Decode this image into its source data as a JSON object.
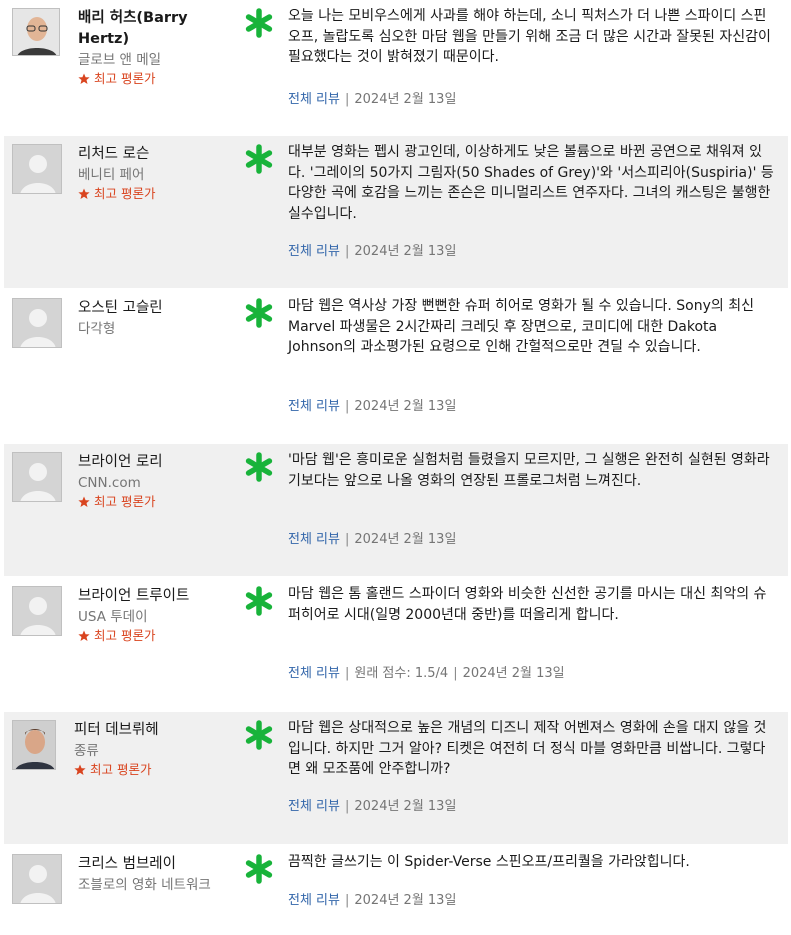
{
  "colors": {
    "accent_link": "#3366aa",
    "top_critic": "#d9441f",
    "fresh_icon": "#18b33a",
    "shaded_bg": "#f0f0f0"
  },
  "icons": {
    "fresh": "fresh-score-icon",
    "top_critic": "star-icon",
    "avatar_placeholder": "avatar-placeholder-icon"
  },
  "reviews": [
    {
      "critic": "배리 허츠(Barry Hertz)",
      "publication": "글로브 앤 메일",
      "top_critic_label": "최고 평론가",
      "quote": "오늘 나는 모비우스에게 사과를 해야 하는데, 소니 픽처스가 더 나쁜 스파이디 스핀오프, 놀랍도록 심오한 마담 웹을 만들기 위해 조금 더 많은 시간과 잘못된 자신감이 필요했다는 것이 밝혀졌기 때문이다.",
      "full_review": "전체 리뷰",
      "date": "2024년 2월 13일"
    },
    {
      "critic": "리처드 로슨",
      "publication": "베니티 페어",
      "top_critic_label": "최고 평론가",
      "quote": "대부분 영화는 펩시 광고인데, 이상하게도 낮은 볼륨으로 바뀐 공연으로 채워져 있다. '그레이의 50가지 그림자(50 Shades of Grey)'와 '서스피리아(Suspiria)' 등 다양한 곡에 호감을 느끼는 존슨은 미니멀리스트 연주자다. 그녀의 캐스팅은 불행한 실수입니다.",
      "full_review": "전체 리뷰",
      "date": "2024년 2월 13일"
    },
    {
      "critic": "오스틴 고슬린",
      "publication": "다각형",
      "quote": "마담 웹은 역사상 가장 뻔뻔한 슈퍼 히어로 영화가 될 수 있습니다. Sony의 최신 Marvel 파생물은 2시간짜리 크레딧 후 장면으로, 코미디에 대한 Dakota Johnson의 과소평가된 요령으로 인해 간헐적으로만 견딜 수 있습니다.",
      "full_review": "전체 리뷰",
      "date": "2024년 2월 13일"
    },
    {
      "critic": "브라이언 로리",
      "publication": "CNN.com",
      "top_critic_label": "최고 평론가",
      "quote": "'마담 웹'은 흥미로운 실험처럼 들렸을지 모르지만, 그 실행은 완전히 실현된 영화라기보다는 앞으로 나올 영화의 연장된 프롤로그처럼 느껴진다.",
      "full_review": "전체 리뷰",
      "date": "2024년 2월 13일"
    },
    {
      "critic": "브라이언 트루이트",
      "publication": "USA 투데이",
      "top_critic_label": "최고 평론가",
      "quote": "마담 웹은 톰 홀랜드 스파이더 영화와 비슷한 신선한 공기를 마시는 대신 최악의 슈퍼히어로 시대(일명 2000년대 중반)를 떠올리게 합니다.",
      "full_review": "전체 리뷰",
      "original_score": "원래 점수: 1.5/4",
      "date": "2024년 2월 13일"
    },
    {
      "critic": "피터 데브뤼헤",
      "publication": "종류",
      "top_critic_label": "최고 평론가",
      "quote": "마담 웹은 상대적으로 높은 개념의 디즈니 제작 어벤져스 영화에 손을 대지 않을 것입니다. 하지만 그거 알아? 티켓은 여전히 더 정식 마블 영화만큼 비쌉니다. 그렇다면 왜 모조품에 안주합니까?",
      "full_review": "전체 리뷰",
      "date": "2024년 2월 13일"
    },
    {
      "critic": "크리스 범브레이",
      "publication": "조블로의 영화 네트워크",
      "quote": "끔찍한 글쓰기는 이 Spider-Verse 스핀오프/프리퀄을 가라앉힙니다.",
      "full_review": "전체 리뷰",
      "date": "2024년 2월 13일"
    }
  ]
}
